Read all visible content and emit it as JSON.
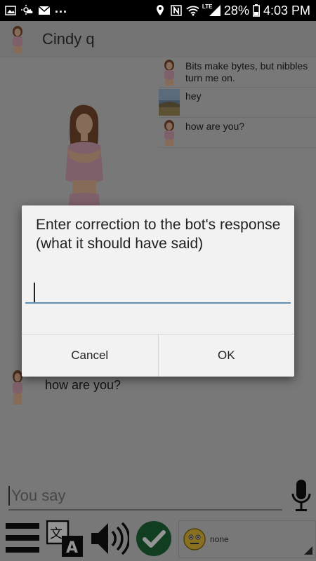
{
  "status_bar": {
    "left_icons": [
      "gallery-icon",
      "weather-icon",
      "mail-icon",
      "more-notifications-icon"
    ],
    "more_text": "...",
    "right_icons": [
      "location-icon",
      "nfc-icon",
      "wifi-icon",
      "lte-signal-icon",
      "battery-icon"
    ],
    "lte_label": "LTE",
    "battery_percent": "28%",
    "time": "4:03 PM"
  },
  "app_bar": {
    "title": "Cindy q"
  },
  "chat": {
    "history": [
      {
        "text": "Bits make bytes, but nibbles turn me on.",
        "avatar": "bot-avatar"
      },
      {
        "text": "hey",
        "avatar": "user-avatar"
      },
      {
        "text": "how are you?",
        "avatar": "bot-avatar"
      }
    ],
    "last_reply": "how are you?"
  },
  "input": {
    "placeholder": "You say"
  },
  "toolbar": {
    "emotion_label": "none"
  },
  "dialog": {
    "message": "Enter correction to the bot's response (what it should have said)",
    "input_value": "",
    "cancel_label": "Cancel",
    "ok_label": "OK"
  },
  "colors": {
    "check_green": "#1e6b3a",
    "dialog_field_underline": "#5b8fb9",
    "overlay": "rgba(0,0,0,0.42)"
  }
}
